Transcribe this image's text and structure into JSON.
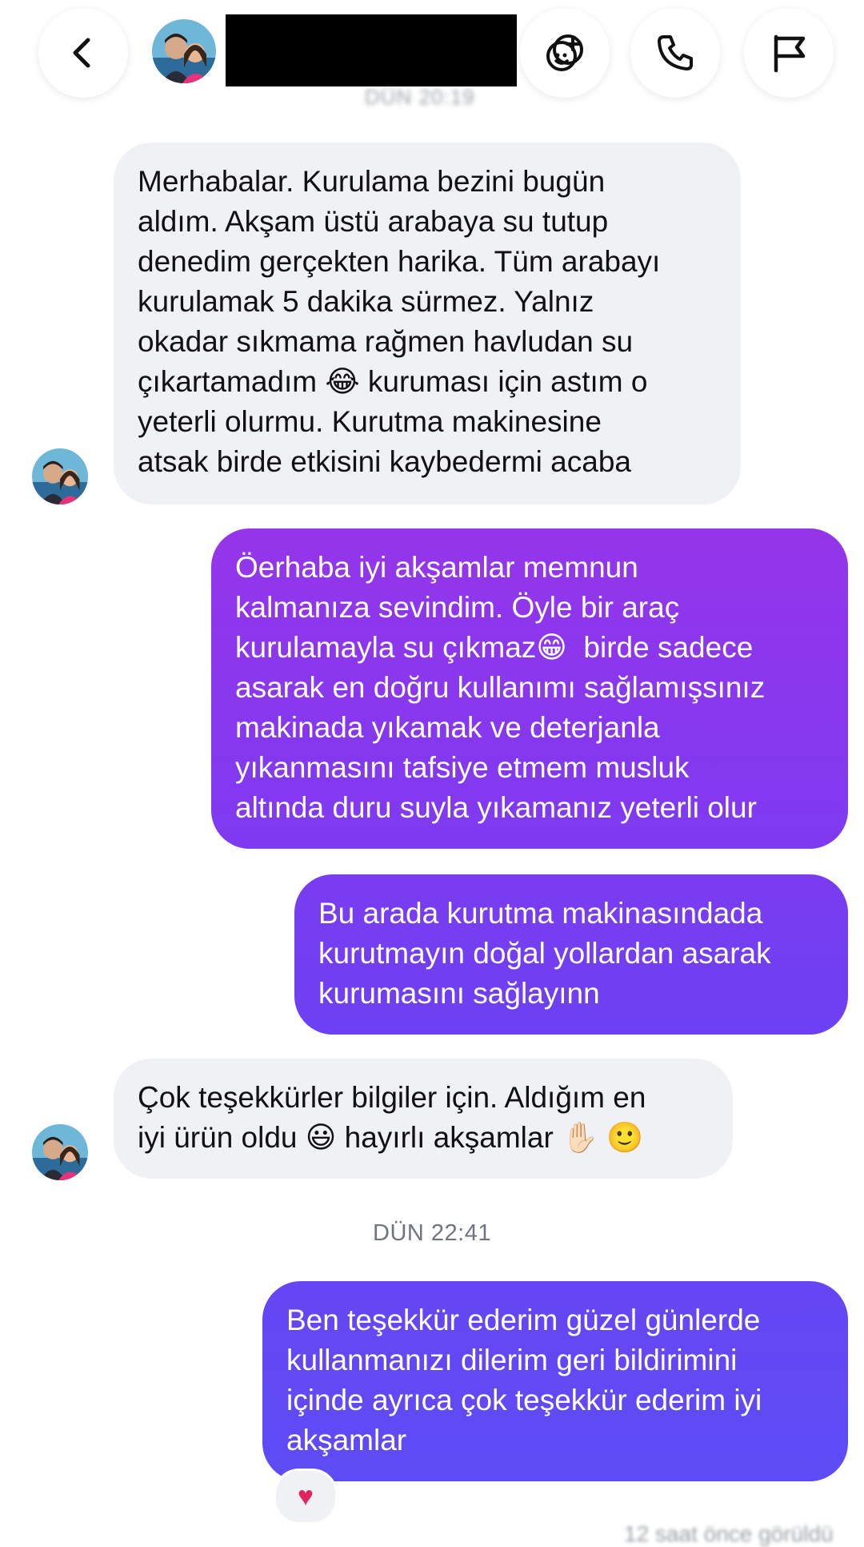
{
  "header": {
    "blurred_timestamp": "DÜN 20:19"
  },
  "messages": [
    {
      "direction": "in",
      "text": "Merhabalar. Kurulama bezini bugün\naldım. Akşam üstü arabaya su tutup\ndenedim gerçekten harika. Tüm arabayı\nkurulamak 5 dakika sürmez. Yalnız\nokadar sıkmama rağmen havludan su\nçıkartamadım 😂 kuruması için astım o\nyeterli olurmu. Kurutma makinesine\natsak birde etkisini kaybedermi acaba"
    },
    {
      "direction": "out",
      "text": "Öerhaba iyi akşamlar memnun\nkalmanıza sevindim. Öyle bir araç\nkurulamayla su çıkmaz😁  birde sadece\nasarak en doğru kullanımı sağlamışsınız\nmakinada yıkamak ve deterjanla\nyıkanmasını tafsiye etmem musluk\naltında duru suyla yıkamanız yeterli olur"
    },
    {
      "direction": "out",
      "text": "Bu arada kurutma makinasındada\nkurutmayın doğal yollardan asarak\nkurumasını sağlayınn"
    },
    {
      "direction": "in",
      "text": "Çok teşekkürler bilgiler için. Aldığım en\niyi ürün oldu 😃 hayırlı akşamlar ✋🏻 🙂"
    },
    {
      "direction": "out",
      "text": "Ben teşekkür ederim güzel günlerde\nkullanmanızı dilerim geri bildirimini\niçinde ayrıca çok teşekkür ederim iyi\nakşamlar"
    }
  ],
  "timestamp_divider": "DÜN 22:41",
  "reaction": "♥",
  "footer_hint": "12 saat önce görüldü",
  "colors": {
    "incoming_bubble": "#eff1f4",
    "outgoing_top": "#9333ea",
    "outgoing_bottom": "#5d4cf5",
    "reaction_heart": "#e0245e"
  },
  "icons": [
    "back-chevron-icon",
    "avatar-photo",
    "video-effects-icon",
    "phone-icon",
    "flag-icon"
  ]
}
